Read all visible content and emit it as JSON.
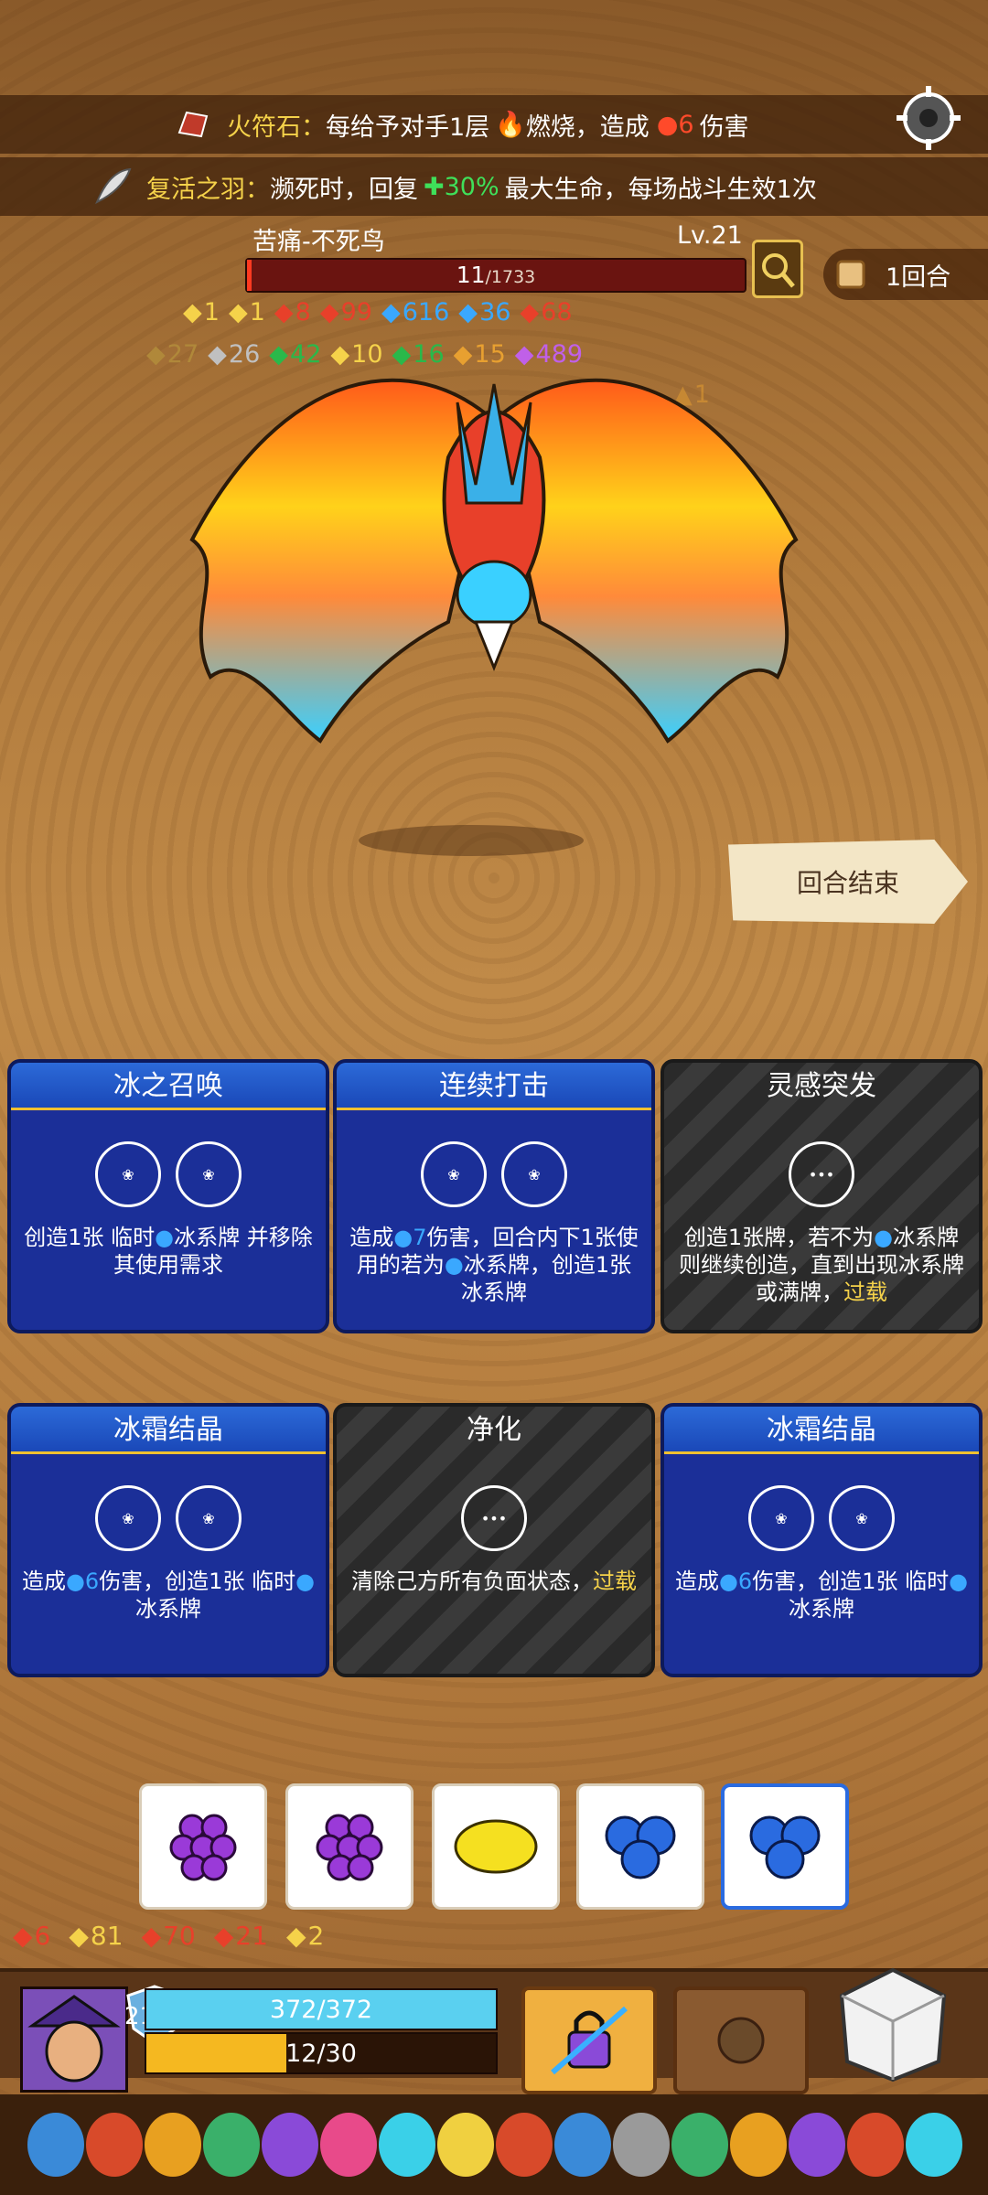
{
  "relics": [
    {
      "name": "火符石：",
      "text_a": "每给予对手1层",
      "text_b": "燃烧，造成",
      "value": "6",
      "text_c": "伤害"
    },
    {
      "name": "复活之羽：",
      "text_a": "濒死时，回复",
      "value": "30%",
      "text_b": "最大生命，每场战斗生效1次"
    }
  ],
  "enemy": {
    "name": "苦痛-不死鸟",
    "level": "Lv.21",
    "hp_current": "11",
    "hp_max": "/1733",
    "hp_fraction": 0.0063,
    "statuses_row1": [
      {
        "icon": "shield-icon",
        "value": "1",
        "color": "#f5d24a"
      },
      {
        "icon": "star-icon",
        "value": "1",
        "color": "#f5d24a"
      },
      {
        "icon": "claw-icon",
        "value": "8",
        "color": "#e8402a"
      },
      {
        "icon": "flame-icon",
        "value": "99",
        "color": "#e8402a"
      },
      {
        "icon": "snowflake-icon",
        "value": "616",
        "color": "#3aa8ff"
      },
      {
        "icon": "speech-icon",
        "value": "36",
        "color": "#3aa8ff"
      },
      {
        "icon": "blood-icon",
        "value": "68",
        "color": "#e8402a"
      }
    ],
    "statuses_row2": [
      {
        "icon": "lock-icon",
        "value": "27",
        "color": "#b0883a"
      },
      {
        "icon": "skull-icon",
        "value": "26",
        "color": "#c0c0c0"
      },
      {
        "icon": "vortex-icon",
        "value": "42",
        "color": "#2ab84a"
      },
      {
        "icon": "triangle-icon",
        "value": "10",
        "color": "#f5d24a"
      },
      {
        "icon": "poison-icon",
        "value": "16",
        "color": "#2ab84a"
      },
      {
        "icon": "wind-icon",
        "value": "15",
        "color": "#e8a030"
      },
      {
        "icon": "splat-icon",
        "value": "489",
        "color": "#c060e8"
      }
    ],
    "status_row3_value": "1"
  },
  "round": {
    "label": "1回合"
  },
  "end_turn": {
    "label": "回合结束"
  },
  "cards": [
    {
      "title": "冰之召唤",
      "style": "blue",
      "slots": 2,
      "desc_a": "创造1张 临时",
      "desc_b": "冰系牌 并移除其使用需求"
    },
    {
      "title": "连续打击",
      "style": "blue",
      "slots": 2,
      "desc_a": "造成",
      "value": "7",
      "desc_b": "伤害，回合内下1张使用的若为",
      "desc_c": "冰系牌，创造1张冰系牌"
    },
    {
      "title": "灵感突发",
      "style": "dark",
      "slots": 1,
      "desc_a": "创造1张牌，若不为",
      "desc_b": "冰系牌则继续创造，直到出现冰系牌或满牌，",
      "keyword": "过载"
    },
    {
      "title": "冰霜结晶",
      "style": "blue",
      "slots": 2,
      "desc_a": "造成",
      "value": "6",
      "desc_b": "伤害，创造1张 临时",
      "desc_c": "冰系牌"
    },
    {
      "title": "净化",
      "style": "dark",
      "slots": 1,
      "desc_a": "清除己方所有负面状态，",
      "keyword": "过载"
    },
    {
      "title": "冰霜结晶",
      "style": "blue",
      "slots": 2,
      "desc_a": "造成",
      "value": "6",
      "desc_b": "伤害，创造1张 临时",
      "desc_c": "冰系牌"
    }
  ],
  "dice": [
    {
      "face": "grape-icon",
      "selected": false
    },
    {
      "face": "grape-icon",
      "selected": false
    },
    {
      "face": "lemon-icon",
      "selected": false
    },
    {
      "face": "blueberry-icon",
      "selected": false
    },
    {
      "face": "blueberry-icon",
      "selected": true
    }
  ],
  "player_statuses": [
    {
      "icon": "gear-burn-icon",
      "value": "6",
      "color": "#e8402a"
    },
    {
      "icon": "star-icon",
      "value": "81",
      "color": "#f5d24a"
    },
    {
      "icon": "shield-red-icon",
      "value": "70",
      "color": "#e8402a"
    },
    {
      "icon": "shield-cross-icon",
      "value": "21",
      "color": "#e8402a"
    },
    {
      "icon": "shield-icon",
      "value": "2",
      "color": "#f5d24a"
    }
  ],
  "player": {
    "armor": "2141",
    "hp": "372/372",
    "hp_fraction": 1.0,
    "energy": "12/30",
    "energy_fraction": 0.4
  },
  "colors": {
    "hp_bar": "#5ad0f0",
    "energy_bar": "#f5b820",
    "enemy_hp": "#ff3a20",
    "card_blue": "#1b2f98"
  }
}
